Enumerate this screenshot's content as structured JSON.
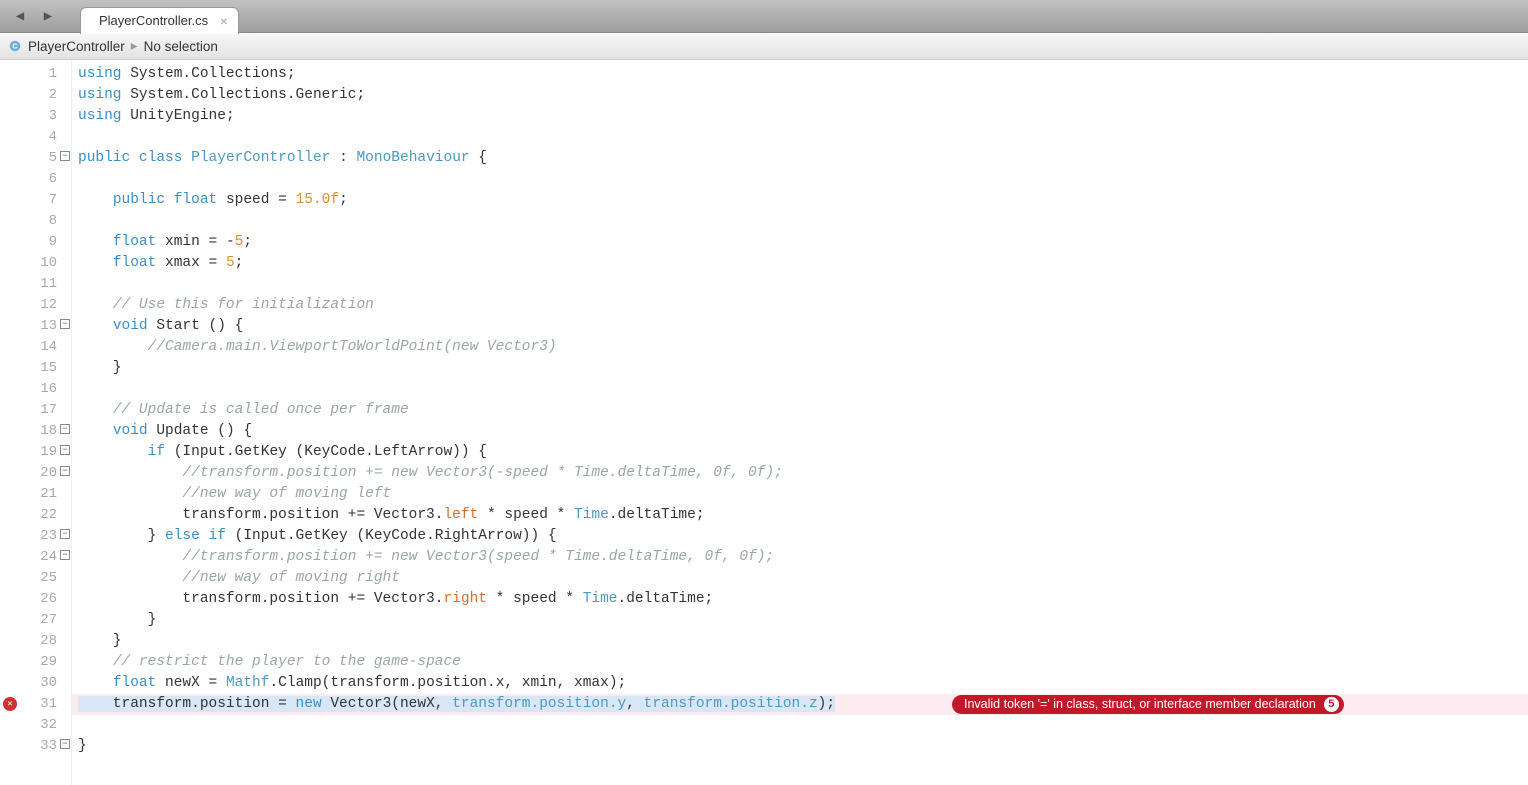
{
  "tab": {
    "title": "PlayerController.cs"
  },
  "breadcrumb": {
    "class": "PlayerController",
    "selection": "No selection"
  },
  "error": {
    "message": "Invalid token '=' in class, struct, or interface member declaration",
    "count": "5",
    "line": 31
  },
  "lines": [
    {
      "n": 1,
      "fold": "",
      "seg": [
        [
          "kw",
          "using"
        ],
        [
          "",
          " "
        ],
        [
          "nsp",
          "System.Collections"
        ],
        [
          "",
          ";"
        ]
      ]
    },
    {
      "n": 2,
      "fold": "",
      "seg": [
        [
          "kw",
          "using"
        ],
        [
          "",
          " "
        ],
        [
          "nsp",
          "System.Collections.Generic"
        ],
        [
          "",
          ";"
        ]
      ]
    },
    {
      "n": 3,
      "fold": "",
      "seg": [
        [
          "kw",
          "using"
        ],
        [
          "",
          " "
        ],
        [
          "nsp",
          "UnityEngine"
        ],
        [
          "",
          ";"
        ]
      ]
    },
    {
      "n": 4,
      "fold": "",
      "seg": [
        [
          "",
          ""
        ]
      ]
    },
    {
      "n": 5,
      "fold": "-",
      "seg": [
        [
          "kw",
          "public"
        ],
        [
          "",
          " "
        ],
        [
          "kw",
          "class"
        ],
        [
          "",
          " "
        ],
        [
          "typ",
          "PlayerController"
        ],
        [
          "",
          " : "
        ],
        [
          "typ",
          "MonoBehaviour"
        ],
        [
          "",
          " {"
        ]
      ]
    },
    {
      "n": 6,
      "fold": "",
      "seg": [
        [
          "",
          ""
        ]
      ]
    },
    {
      "n": 7,
      "fold": "",
      "seg": [
        [
          "",
          "    "
        ],
        [
          "kw",
          "public"
        ],
        [
          "",
          " "
        ],
        [
          "kw",
          "float"
        ],
        [
          "",
          " speed = "
        ],
        [
          "num",
          "15.0f"
        ],
        [
          "",
          ";"
        ]
      ]
    },
    {
      "n": 8,
      "fold": "",
      "seg": [
        [
          "",
          ""
        ]
      ]
    },
    {
      "n": 9,
      "fold": "",
      "seg": [
        [
          "",
          "    "
        ],
        [
          "kw",
          "float"
        ],
        [
          "",
          " xmin = -"
        ],
        [
          "num",
          "5"
        ],
        [
          "",
          ";"
        ]
      ]
    },
    {
      "n": 10,
      "fold": "",
      "seg": [
        [
          "",
          "    "
        ],
        [
          "kw",
          "float"
        ],
        [
          "",
          " xmax = "
        ],
        [
          "num",
          "5"
        ],
        [
          "",
          ";"
        ]
      ]
    },
    {
      "n": 11,
      "fold": "",
      "seg": [
        [
          "",
          ""
        ]
      ]
    },
    {
      "n": 12,
      "fold": "",
      "seg": [
        [
          "",
          "    "
        ],
        [
          "cmt",
          "// Use this for initialization"
        ]
      ]
    },
    {
      "n": 13,
      "fold": "-",
      "seg": [
        [
          "",
          "    "
        ],
        [
          "kw",
          "void"
        ],
        [
          "",
          " Start () {"
        ]
      ]
    },
    {
      "n": 14,
      "fold": "",
      "seg": [
        [
          "",
          "        "
        ],
        [
          "cmt",
          "//Camera.main.ViewportToWorldPoint(new Vector3)"
        ]
      ]
    },
    {
      "n": 15,
      "fold": "",
      "seg": [
        [
          "",
          "    }"
        ]
      ]
    },
    {
      "n": 16,
      "fold": "",
      "seg": [
        [
          "",
          ""
        ]
      ]
    },
    {
      "n": 17,
      "fold": "",
      "seg": [
        [
          "",
          "    "
        ],
        [
          "cmt",
          "// Update is called once per frame"
        ]
      ]
    },
    {
      "n": 18,
      "fold": "-",
      "seg": [
        [
          "",
          "    "
        ],
        [
          "kw",
          "void"
        ],
        [
          "",
          " Update () {"
        ]
      ]
    },
    {
      "n": 19,
      "fold": "-",
      "seg": [
        [
          "",
          "        "
        ],
        [
          "kw",
          "if"
        ],
        [
          "",
          " (Input.GetKey (KeyCode.LeftArrow)) {"
        ]
      ]
    },
    {
      "n": 20,
      "fold": "-",
      "seg": [
        [
          "",
          "            "
        ],
        [
          "cmt",
          "//transform.position += new Vector3(-speed * Time.deltaTime, 0f, 0f);"
        ]
      ]
    },
    {
      "n": 21,
      "fold": "",
      "seg": [
        [
          "",
          "            "
        ],
        [
          "cmt",
          "//new way of moving left"
        ]
      ]
    },
    {
      "n": 22,
      "fold": "",
      "seg": [
        [
          "",
          "            transform.position += Vector3."
        ],
        [
          "prop",
          "left"
        ],
        [
          "",
          " * speed * "
        ],
        [
          "typ",
          "Time"
        ],
        [
          "",
          ".deltaTime;"
        ]
      ]
    },
    {
      "n": 23,
      "fold": "-",
      "seg": [
        [
          "",
          "        } "
        ],
        [
          "kw",
          "else"
        ],
        [
          "",
          " "
        ],
        [
          "kw",
          "if"
        ],
        [
          "",
          " (Input.GetKey (KeyCode.RightArrow)) {"
        ]
      ]
    },
    {
      "n": 24,
      "fold": "-",
      "seg": [
        [
          "",
          "            "
        ],
        [
          "cmt",
          "//transform.position += new Vector3(speed * Time.deltaTime, 0f, 0f);"
        ]
      ]
    },
    {
      "n": 25,
      "fold": "",
      "seg": [
        [
          "",
          "            "
        ],
        [
          "cmt",
          "//new way of moving right"
        ]
      ]
    },
    {
      "n": 26,
      "fold": "",
      "seg": [
        [
          "",
          "            transform.position += Vector3."
        ],
        [
          "prop",
          "right"
        ],
        [
          "",
          " * speed * "
        ],
        [
          "typ",
          "Time"
        ],
        [
          "",
          ".deltaTime;"
        ]
      ]
    },
    {
      "n": 27,
      "fold": "",
      "seg": [
        [
          "",
          "        }"
        ]
      ]
    },
    {
      "n": 28,
      "fold": "",
      "seg": [
        [
          "",
          "    }"
        ]
      ]
    },
    {
      "n": 29,
      "fold": "",
      "seg": [
        [
          "",
          "    "
        ],
        [
          "cmt",
          "// restrict the player to the game-space"
        ]
      ]
    },
    {
      "n": 30,
      "fold": "",
      "seg": [
        [
          "",
          "    "
        ],
        [
          "kw",
          "float"
        ],
        [
          "",
          " newX = "
        ],
        [
          "typ",
          "Mathf"
        ],
        [
          "",
          ".Clamp(transform.position.x, xmin, xmax);"
        ]
      ]
    },
    {
      "n": 31,
      "fold": "",
      "err": true,
      "seg": [
        [
          "hl",
          "    transform.position = "
        ],
        [
          "hlkw",
          "new"
        ],
        [
          "hl",
          " Vector3(newX, "
        ],
        [
          "hltyp",
          "transform.position.y"
        ],
        [
          "hl",
          ", "
        ],
        [
          "hltyp",
          "transform.position.z"
        ],
        [
          "hl",
          ");"
        ],
        [
          "",
          " "
        ]
      ]
    },
    {
      "n": 32,
      "fold": "",
      "seg": [
        [
          "",
          ""
        ]
      ]
    },
    {
      "n": 33,
      "fold": "-",
      "seg": [
        [
          "",
          "}"
        ]
      ]
    }
  ]
}
